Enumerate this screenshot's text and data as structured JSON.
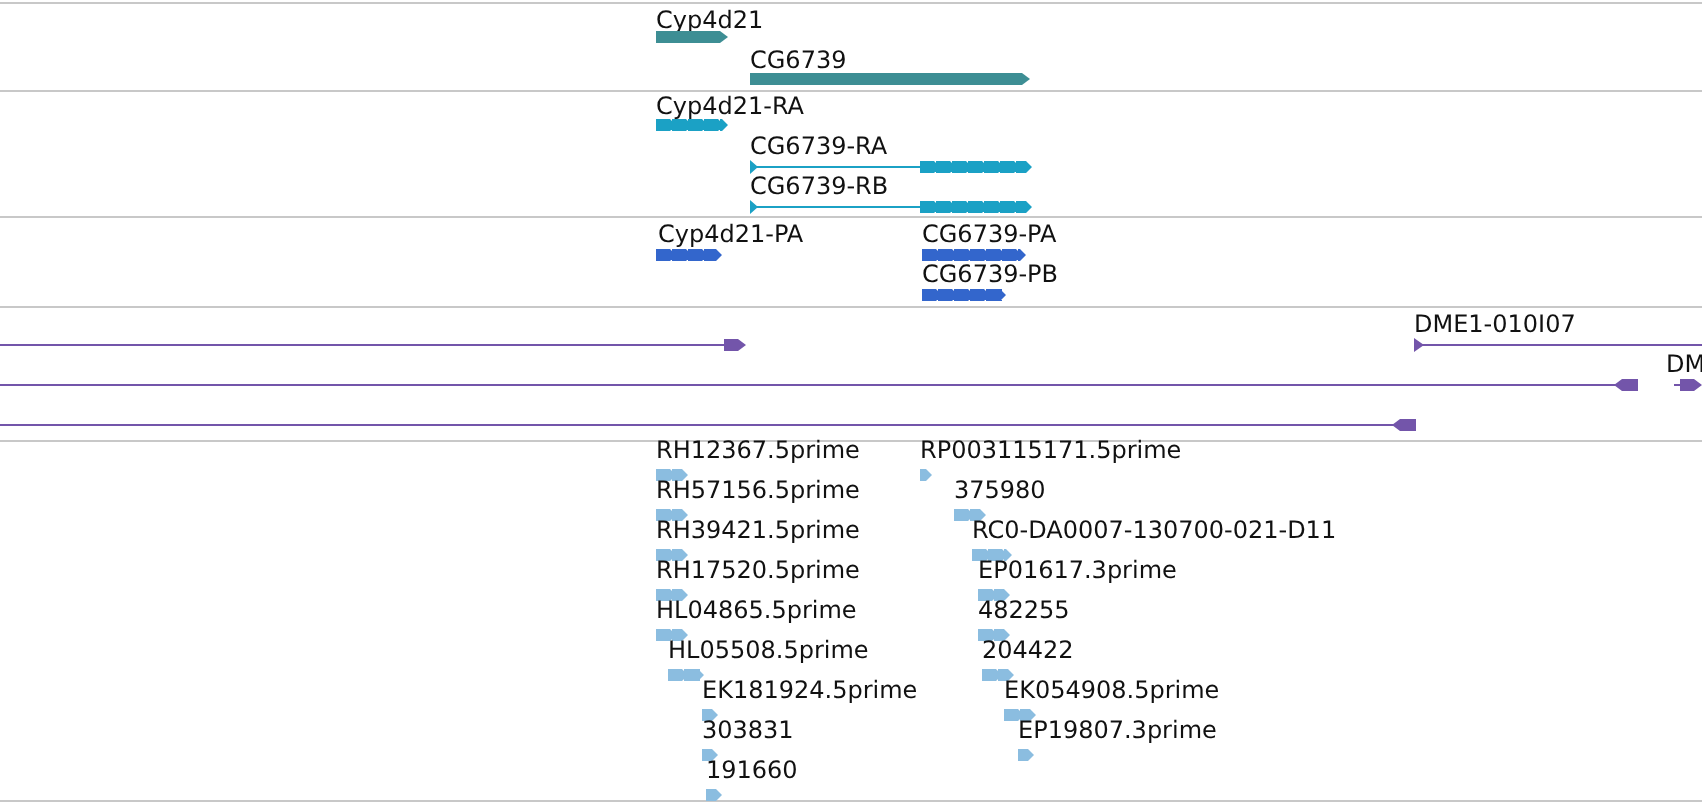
{
  "tracks": [
    {
      "kind": "bar",
      "color": "#3d8e94",
      "features": [
        {
          "label": "Cyp4d21",
          "reverse": false
        },
        {
          "label": "CG6739",
          "reverse": false
        }
      ]
    },
    {
      "kind": "exons",
      "color": "#1ba1c5",
      "features": [
        {
          "label": "Cyp4d21-RA",
          "reverse": false
        },
        {
          "label": "CG6739-RA",
          "reverse": false
        },
        {
          "label": "CG6739-RB",
          "reverse": false
        }
      ]
    },
    {
      "kind": "exons",
      "color": "#3366cc",
      "features": [
        {
          "label": "Cyp4d21-PA",
          "reverse": false
        },
        {
          "label": "CG6739-PA",
          "reverse": false
        },
        {
          "label": "CG6739-PB",
          "reverse": false
        }
      ]
    },
    {
      "kind": "line",
      "color": "#7355aa",
      "features": [
        {
          "reverse": false
        },
        {
          "label": "DME1-010I07",
          "reverse": false
        },
        {
          "reverse": true
        },
        {
          "label": "DM",
          "reverse": false
        },
        {
          "reverse": true
        }
      ]
    },
    {
      "kind": "chevrons",
      "color": "#8bbde0",
      "features": [
        {
          "label": "RH12367.5prime",
          "reverse": false
        },
        {
          "label": "RH57156.5prime",
          "reverse": false
        },
        {
          "label": "RH39421.5prime",
          "reverse": false
        },
        {
          "label": "RH17520.5prime",
          "reverse": false
        },
        {
          "label": "HL04865.5prime",
          "reverse": false
        },
        {
          "label": "HL05508.5prime",
          "reverse": false
        },
        {
          "label": "EK181924.5prime",
          "reverse": false
        },
        {
          "label": "303831",
          "reverse": false
        },
        {
          "label": "191660",
          "reverse": false
        },
        {
          "label": "RP003115171.5prime",
          "reverse": false
        },
        {
          "label": "375980",
          "reverse": false
        },
        {
          "label": "RC0-DA0007-130700-021-D11",
          "reverse": false
        },
        {
          "label": "EP01617.3prime",
          "reverse": false
        },
        {
          "label": "482255",
          "reverse": false
        },
        {
          "label": "204422",
          "reverse": false
        },
        {
          "label": "EK054908.5prime",
          "reverse": false
        },
        {
          "label": "EP19807.3prime",
          "reverse": false
        }
      ]
    }
  ]
}
